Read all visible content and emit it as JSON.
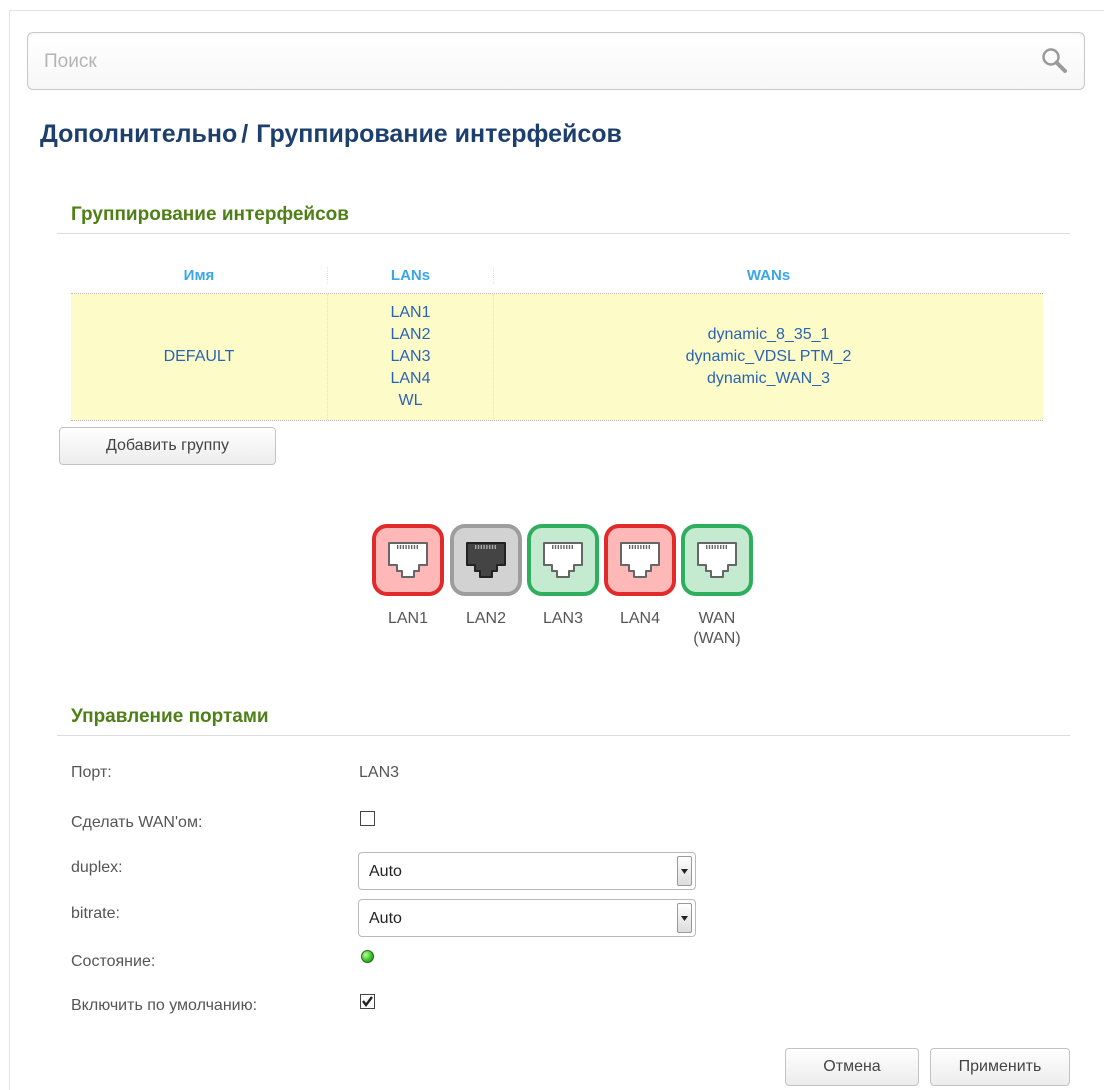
{
  "search": {
    "placeholder": "Поиск"
  },
  "breadcrumb": {
    "parent": "Дополнительно",
    "separator": "/",
    "current": "Группирование интерфейсов"
  },
  "grouping": {
    "title": "Группирование интерфейсов",
    "columns": [
      "Имя",
      "LANs",
      "WANs"
    ],
    "rows": [
      {
        "name": "DEFAULT",
        "lans": [
          "LAN1",
          "LAN2",
          "LAN3",
          "LAN4",
          "WL"
        ],
        "wans": [
          "dynamic_8_35_1",
          "dynamic_VDSL PTM_2",
          "dynamic_WAN_3"
        ]
      }
    ],
    "add_button": "Добавить группу"
  },
  "ports": [
    {
      "label": "LAN1",
      "sublabel": "",
      "status": "red"
    },
    {
      "label": "LAN2",
      "sublabel": "",
      "status": "gray"
    },
    {
      "label": "LAN3",
      "sublabel": "",
      "status": "green"
    },
    {
      "label": "LAN4",
      "sublabel": "",
      "status": "red"
    },
    {
      "label": "WAN",
      "sublabel": "(WAN)",
      "status": "green"
    }
  ],
  "colors": {
    "red": "#e12b2b",
    "gray": "#9d9d9d",
    "green": "#2faf5e",
    "accent_title": "#4f7f17",
    "link": "#2a63b3"
  },
  "port_control": {
    "title": "Управление портами",
    "port_label": "Порт:",
    "port_value": "LAN3",
    "make_wan_label": "Сделать WAN'ом:",
    "make_wan_checked": false,
    "duplex_label": "duplex:",
    "duplex_value": "Auto",
    "bitrate_label": "bitrate:",
    "bitrate_value": "Auto",
    "state_label": "Состояние:",
    "state_color": "#33bb22",
    "enable_default_label": "Включить по умолчанию:",
    "enable_default_checked": true
  },
  "buttons": {
    "cancel": "Отмена",
    "apply": "Применить"
  }
}
